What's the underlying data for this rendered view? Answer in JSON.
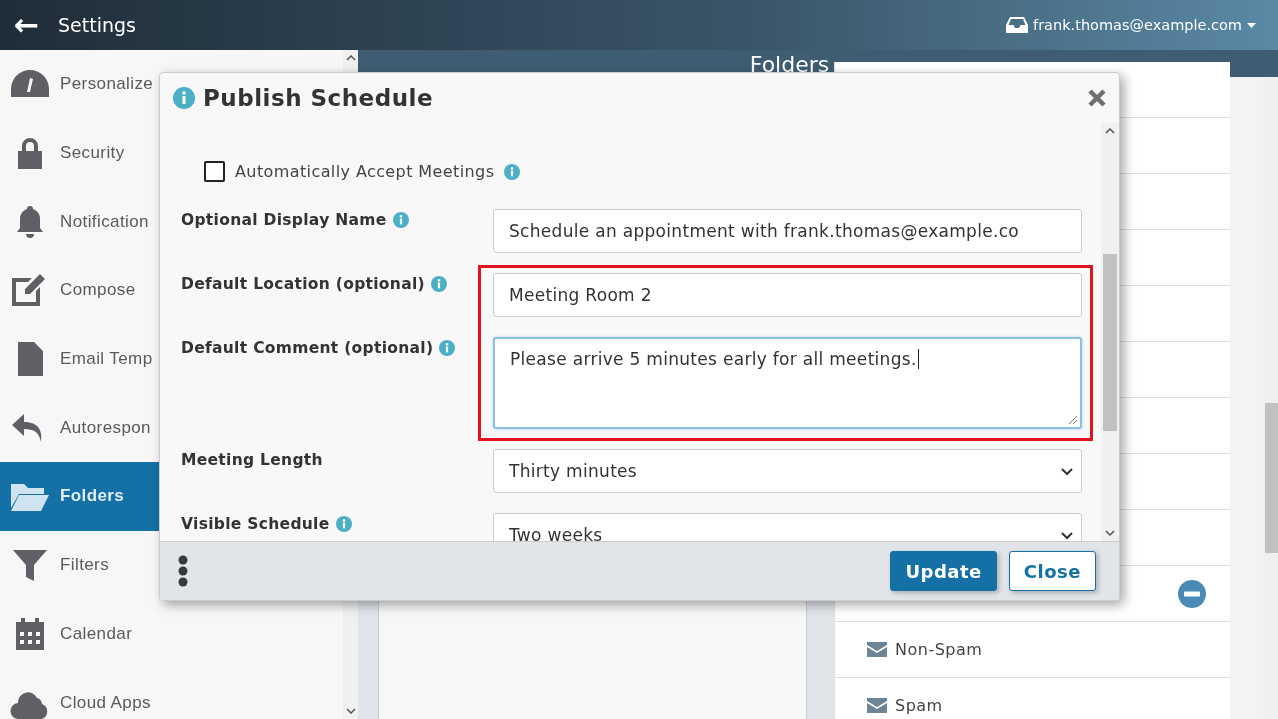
{
  "header": {
    "back": "←",
    "title": "Settings",
    "account": "frank.thomas@example.com"
  },
  "sidebar": {
    "items": [
      {
        "label": "Personalize",
        "selected": false
      },
      {
        "label": "Security",
        "selected": false
      },
      {
        "label": "Notification",
        "selected": false
      },
      {
        "label": "Compose",
        "selected": false
      },
      {
        "label": "Email Temp",
        "selected": false
      },
      {
        "label": "Autorespon",
        "selected": false
      },
      {
        "label": "Folders",
        "selected": true
      },
      {
        "label": "Filters",
        "selected": false
      },
      {
        "label": "Calendar",
        "selected": false
      },
      {
        "label": "Cloud Apps",
        "selected": false
      }
    ]
  },
  "page_title": "Folders",
  "folders": [
    {
      "kind": "removable"
    },
    {
      "kind": "mail",
      "label": "Non-Spam"
    },
    {
      "kind": "mail",
      "label": "Spam"
    }
  ],
  "dialog": {
    "title": "Publish Schedule",
    "checkbox": {
      "label": "Automatically Accept Meetings",
      "checked": false
    },
    "sections": [
      {
        "highlighted": false,
        "fields": [
          {
            "label": "Optional Display Name",
            "info": true,
            "kind": "text",
            "value": "Schedule an appointment with frank.thomas@example.co",
            "focused": false
          }
        ]
      },
      {
        "highlighted": true,
        "fields": [
          {
            "label": "Default Location (optional)",
            "info": true,
            "kind": "text",
            "value": "Meeting Room 2",
            "focused": false
          },
          {
            "label": "Default Comment (optional)",
            "info": true,
            "kind": "textarea",
            "value": "Please arrive 5 minutes early for all meetings.",
            "focused": true
          }
        ]
      },
      {
        "highlighted": false,
        "fields": [
          {
            "label": "Meeting Length",
            "info": false,
            "kind": "select",
            "value": "Thirty minutes",
            "focused": false
          },
          {
            "label": "Visible Schedule",
            "info": true,
            "kind": "select",
            "value": "Two weeks",
            "focused": false
          }
        ]
      }
    ],
    "buttons": [
      {
        "label": "Update",
        "primary": true
      },
      {
        "label": "Close",
        "primary": false
      }
    ]
  }
}
